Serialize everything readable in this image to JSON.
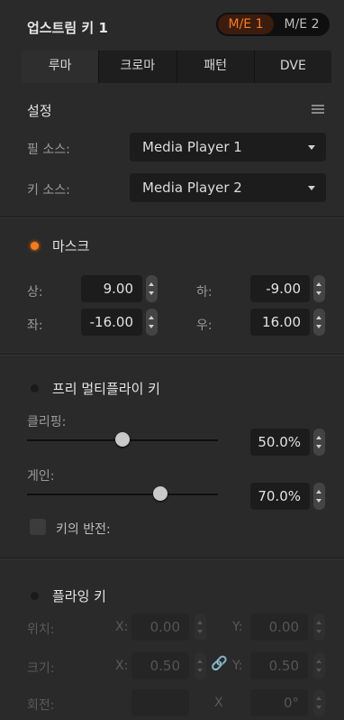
{
  "header": {
    "title": "업스트림 키 1",
    "me_active": "M/E 1",
    "me_inactive": "M/E 2"
  },
  "tabs": [
    "루마",
    "크로마",
    "패턴",
    "DVE"
  ],
  "settings": {
    "title": "설정",
    "fill_source_label": "필 소스:",
    "fill_source_value": "Media Player 1",
    "key_source_label": "키 소스:",
    "key_source_value": "Media Player 2"
  },
  "mask": {
    "title": "마스크",
    "top_label": "상:",
    "top_value": "9.00",
    "bottom_label": "하:",
    "bottom_value": "-9.00",
    "left_label": "좌:",
    "left_value": "-16.00",
    "right_label": "우:",
    "right_value": "16.00"
  },
  "premultiply": {
    "title": "프리 멀티플라이 키",
    "clip_label": "클리핑:",
    "clip_value": "50.0%",
    "clip_fraction": 0.5,
    "gain_label": "게인:",
    "gain_value": "70.0%",
    "gain_fraction": 0.7,
    "invert_label": "키의 반전:"
  },
  "flying": {
    "title": "플라잉 키",
    "position_label": "위치:",
    "pos_x_label": "X:",
    "pos_x_value": "0.00",
    "pos_y_label": "Y:",
    "pos_y_value": "0.00",
    "size_label": "크기:",
    "size_x_label": "X:",
    "size_x_value": "0.50",
    "size_y_label": "Y:",
    "size_y_value": "0.50",
    "rotation_label": "회전:",
    "rot_x_label": "X",
    "rot_value": "0°"
  },
  "colors": {
    "accent": "#ff7a1a",
    "panel": "#2a2a2a",
    "field": "#1c1c1c"
  },
  "icons": [
    "menu-icon",
    "caret-down-icon",
    "stepper-icon",
    "link-icon"
  ]
}
